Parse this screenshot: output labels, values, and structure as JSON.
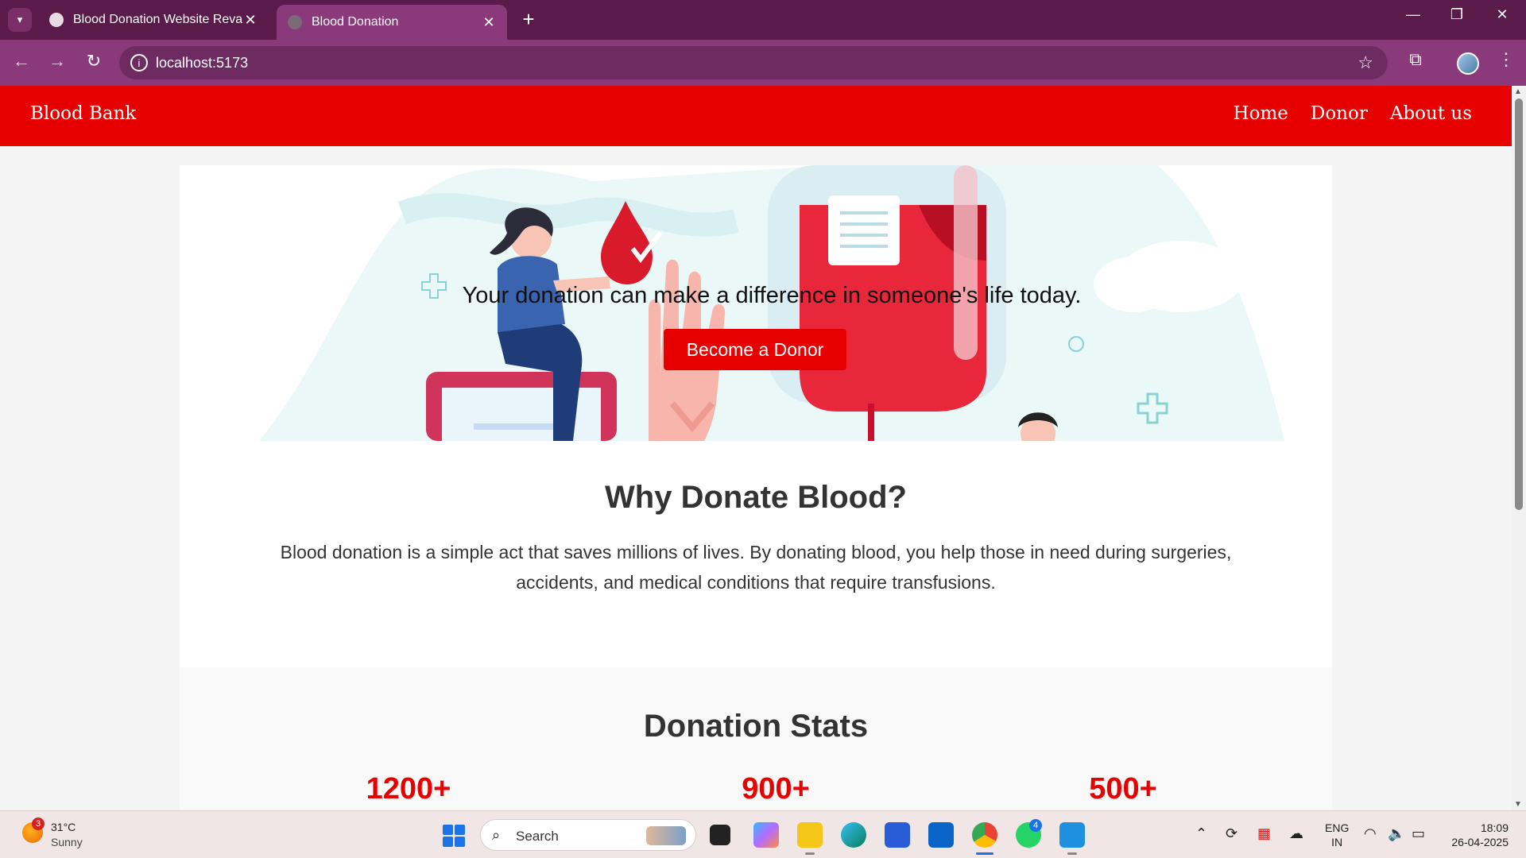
{
  "browser": {
    "tabs": [
      {
        "title": "Blood Donation Website Revam"
      },
      {
        "title": "Blood Donation"
      }
    ],
    "url": "localhost:5173"
  },
  "site": {
    "brand": "Blood Bank",
    "nav": [
      "Home",
      "Donor",
      "About us"
    ],
    "hero": {
      "text": "Your donation can make a difference in someone's life today.",
      "button": "Become a Donor"
    },
    "why": {
      "title": "Why Donate Blood?",
      "text": "Blood donation is a simple act that saves millions of lives. By donating blood, you help those in need during surgeries, accidents, and medical conditions that require transfusions."
    },
    "stats": {
      "title": "Donation Stats",
      "values": [
        "1200+",
        "900+",
        "500+"
      ]
    }
  },
  "taskbar": {
    "weather_badge": "3",
    "weather_temp": "31°C",
    "weather_desc": "Sunny",
    "search": "Search",
    "whatsapp_badge": "4",
    "lang": [
      "ENG",
      "IN"
    ],
    "time": "18:09",
    "date": "26-04-2025"
  },
  "colors": {
    "brand_red": "#e60000",
    "chrome_purple": "#5a1a4a"
  }
}
